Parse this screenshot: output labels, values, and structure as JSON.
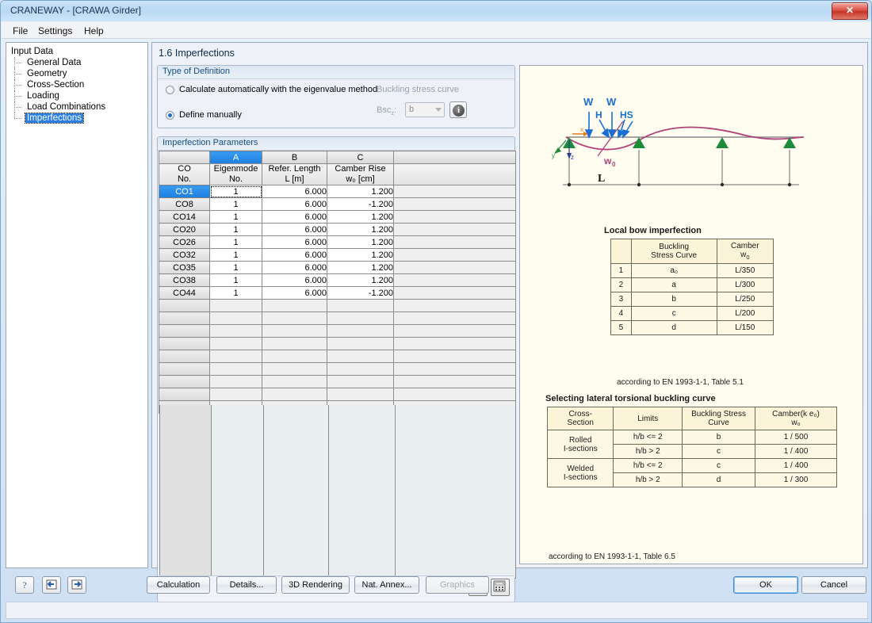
{
  "window": {
    "title": "CRANEWAY - [CRAWA Girder]",
    "close_label": "✕"
  },
  "menu": [
    {
      "label": "File"
    },
    {
      "label": "Settings"
    },
    {
      "label": "Help"
    }
  ],
  "sidebar": {
    "root": "Input Data",
    "items": [
      {
        "label": "General Data"
      },
      {
        "label": "Geometry"
      },
      {
        "label": "Cross-Section"
      },
      {
        "label": "Loading"
      },
      {
        "label": "Load Combinations"
      },
      {
        "label": "Imperfections"
      }
    ],
    "selected": "Imperfections"
  },
  "page": {
    "title": "1.6  Imperfections"
  },
  "type_of_definition": {
    "group_title": "Type of Definition",
    "option_auto": "Calculate automatically with the eigenvalue method",
    "option_manual": "Define manually",
    "selected": "Define manually",
    "buckling_stress_curve_label": "Buckling stress curve",
    "bsc_label": "Bsc",
    "bsc_sub": "z",
    "bsc_colon": ":",
    "bsc_value": "b",
    "info_glyph": "i"
  },
  "imperfection_parameters": {
    "group_title": "Imperfection Parameters",
    "column_letters": [
      "A",
      "B",
      "C"
    ],
    "selected_column": "A",
    "headers": {
      "row_header_line1": "CO",
      "row_header_line2": "No.",
      "a_line1": "Eigenmode",
      "a_line2": "No.",
      "b_line1": "Refer. Length",
      "b_line2": "L [m]",
      "c_line1": "Camber Rise",
      "c_line2": "w₀ [cm]"
    },
    "rows": [
      {
        "co": "CO1",
        "eigenmode": "1",
        "length": "6.000",
        "camber": "1.200"
      },
      {
        "co": "CO8",
        "eigenmode": "1",
        "length": "6.000",
        "camber": "-1.200"
      },
      {
        "co": "CO14",
        "eigenmode": "1",
        "length": "6.000",
        "camber": "1.200"
      },
      {
        "co": "CO20",
        "eigenmode": "1",
        "length": "6.000",
        "camber": "1.200"
      },
      {
        "co": "CO26",
        "eigenmode": "1",
        "length": "6.000",
        "camber": "1.200"
      },
      {
        "co": "CO32",
        "eigenmode": "1",
        "length": "6.000",
        "camber": "1.200"
      },
      {
        "co": "CO35",
        "eigenmode": "1",
        "length": "6.000",
        "camber": "1.200"
      },
      {
        "co": "CO38",
        "eigenmode": "1",
        "length": "6.000",
        "camber": "1.200"
      },
      {
        "co": "CO44",
        "eigenmode": "1",
        "length": "6.000",
        "camber": "-1.200"
      }
    ],
    "empty_row_count": 9,
    "selected_row": "CO1",
    "footer_buttons": [
      {
        "name": "open-dialog-icon"
      },
      {
        "name": "calculator-icon"
      }
    ]
  },
  "graphics": {
    "diagram": {
      "load_labels": [
        "W",
        "W",
        "H",
        "HS"
      ],
      "camber_label": "w",
      "camber_sub": "0",
      "span_label": "L",
      "axis_x": "x",
      "axis_y": "y",
      "axis_z": "z"
    },
    "table1": {
      "caption": "Local bow imperfection",
      "headers": [
        "",
        "Buckling\nStress Curve",
        "Camber\nw₀"
      ],
      "header_col2_line1": "Buckling",
      "header_col2_line2": "Stress Curve",
      "header_col3_line1": "Camber",
      "header_col3_line2": "w",
      "header_col3_sub": "0",
      "rows": [
        {
          "no": "1",
          "curve": "a₀",
          "camber": "L/350"
        },
        {
          "no": "2",
          "curve": "a",
          "camber": "L/300"
        },
        {
          "no": "3",
          "curve": "b",
          "camber": "L/250"
        },
        {
          "no": "4",
          "curve": "c",
          "camber": "L/200"
        },
        {
          "no": "5",
          "curve": "d",
          "camber": "L/150"
        }
      ],
      "note": "according to EN 1993-1-1, Table 5.1"
    },
    "table2": {
      "caption": "Selecting lateral torsional buckling curve",
      "headers": {
        "c1_l1": "Cross-",
        "c1_l2": "Section",
        "c2": "Limits",
        "c3_l1": "Buckling Stress",
        "c3_l2": "Curve",
        "c4_l1": "Camber(k e₀)",
        "c4_l2": "w₀"
      },
      "groups": [
        {
          "section_l1": "Rolled",
          "section_l2": "I-sections",
          "rows": [
            {
              "limits": "h/b <= 2",
              "curve": "b",
              "camber": "1 / 500"
            },
            {
              "limits": "h/b > 2",
              "curve": "c",
              "camber": "1 / 400"
            }
          ]
        },
        {
          "section_l1": "Welded",
          "section_l2": "I-sections",
          "rows": [
            {
              "limits": "h/b <= 2",
              "curve": "c",
              "camber": "1 / 400"
            },
            {
              "limits": "h/b > 2",
              "curve": "d",
              "camber": "1 / 300"
            }
          ]
        }
      ],
      "note": "according to EN 1993-1-1, Table 6.5"
    }
  },
  "bottom_bar": {
    "help_glyph": "?",
    "prev_label": "",
    "next_label": "",
    "buttons": [
      {
        "label": "Calculation",
        "disabled": false
      },
      {
        "label": "Details...",
        "disabled": false
      },
      {
        "label": "3D Rendering",
        "disabled": false
      },
      {
        "label": "Nat. Annex...",
        "disabled": false
      },
      {
        "label": "Graphics",
        "disabled": true
      }
    ],
    "ok": "OK",
    "cancel": "Cancel"
  },
  "colors": {
    "accent": "#1d7fe0",
    "title_text": "#20364f",
    "close_red": "#c33324",
    "diagram_load": "#1a6fd4",
    "diagram_support": "#1e8b3a",
    "diagram_curve": "#b0427a"
  }
}
